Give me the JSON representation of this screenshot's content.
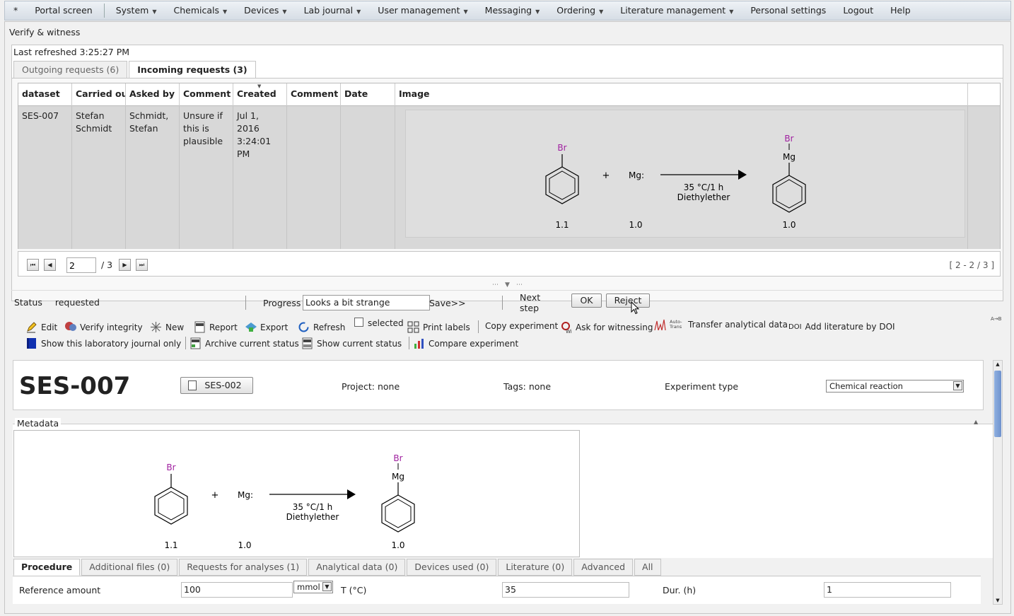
{
  "menu": {
    "items": [
      "*",
      "Portal screen",
      "System",
      "Chemicals",
      "Devices",
      "Lab journal",
      "User management",
      "Messaging",
      "Ordering",
      "Literature management",
      "Personal settings",
      "Logout",
      "Help"
    ]
  },
  "window": {
    "title": "Verify & witness",
    "last_refreshed": "Last refreshed 3:25:27 PM"
  },
  "request_tabs": {
    "outgoing": "Outgoing requests (6)",
    "incoming": "Incoming requests (3)"
  },
  "grid": {
    "columns": [
      "dataset",
      "Carried ou",
      "Asked by",
      "Comment",
      "Created",
      "Comment",
      "Date",
      "Image"
    ],
    "row": {
      "dataset": "SES-007",
      "carried_out": "Stefan Schmidt",
      "asked_by": "Schmidt, Stefan",
      "comment": "Unsure if this is plausible",
      "created": "Jul 1, 2016 3:24:01 PM",
      "comment2": "",
      "date": ""
    }
  },
  "reaction": {
    "reactant1_label": "Br",
    "plus": "+",
    "reactant2_label": "Mg:",
    "conditions_line1": "35 °C/1 h",
    "conditions_line2": "Diethylether",
    "product_label_top": "Br",
    "product_label_mid": "Mg",
    "eq1": "1.1",
    "eq2": "1.0",
    "eq3": "1.0"
  },
  "pager": {
    "current": "2",
    "total": "/ 3",
    "range": "[ 2 - 2 / 3 ]"
  },
  "status": {
    "label": "Status",
    "value": "requested",
    "progress_label": "Progress",
    "progress_value": "Looks a bit strange",
    "save": "Save>>",
    "next_step": "Next step",
    "ok": "OK",
    "reject": "Reject"
  },
  "toolbar": {
    "edit": "Edit",
    "verify": "Verify integrity",
    "new": "New",
    "report": "Report",
    "export": "Export",
    "refresh": "Refresh",
    "selected": "selected",
    "print_labels": "Print labels",
    "copy_experiment": "Copy experiment",
    "ask_witnessing": "Ask for witnessing",
    "auto_trans": "Auto-Trans",
    "transfer": "Transfer analytical data",
    "doi": "DOI",
    "add_lit": "Add literature by DOI",
    "show_journal": "Show this laboratory journal only",
    "archive": "Archive current status",
    "show_status": "Show current status",
    "compare": "Compare experiment",
    "corner": "A→B"
  },
  "document": {
    "id": "SES-007",
    "linked": "SES-002",
    "project": "Project: none",
    "tags": "Tags: none",
    "exp_type_label": "Experiment type",
    "exp_type_value": "Chemical reaction",
    "metadata": "Metadata"
  },
  "detail_tabs": [
    "Procedure",
    "Additional files (0)",
    "Requests for analyses (1)",
    "Analytical data (0)",
    "Devices used (0)",
    "Literature (0)",
    "Advanced",
    "All"
  ],
  "procedure": {
    "ref_amount_label": "Reference amount",
    "ref_amount": "100",
    "unit": "mmol",
    "temp_label": "T (°C)",
    "temp": "35",
    "dur_label": "Dur. (h)",
    "dur": "1"
  }
}
